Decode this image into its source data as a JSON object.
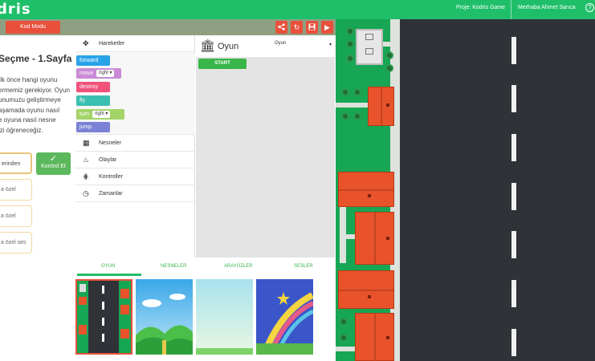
{
  "header": {
    "logo": "dris",
    "project": "Proje: Kodris Game",
    "user": "Merhaba Ahmet Sarıca",
    "help": "?"
  },
  "toolbar": {
    "mode_button": "Kod Modu",
    "icons": [
      "share-icon",
      "reset-icon",
      "save-icon",
      "play-icon"
    ]
  },
  "lesson": {
    "title": "Seçme - 1.Sayfa",
    "paragraph_lines": [
      "Ilk önce hangi oyunu",
      "ermemiz gerekiyor. Oyun",
      "unumuzu geliştirmeye",
      "aşamada oyunu nasıl",
      "e oyuna nasıl nesne",
      "izi öğreneceğiz."
    ],
    "answers": [
      "erinden",
      "a özel",
      "a özel",
      "a özel ses"
    ],
    "check_button": "Kontrol Et"
  },
  "palette": {
    "categories": [
      {
        "label": "Hareketler",
        "icon": "move-arrows-icon"
      },
      {
        "label": "Nesneler",
        "icon": "grid-icon"
      },
      {
        "label": "Olaylar",
        "icon": "fire-icon"
      },
      {
        "label": "Kontroller",
        "icon": "sliders-icon"
      },
      {
        "label": "Zamanlar",
        "icon": "clock-icon"
      }
    ],
    "blocks": [
      {
        "label": "forward",
        "color": "#29a3e8"
      },
      {
        "label": "move",
        "option": "right",
        "color": "#c98bd6"
      },
      {
        "label": "destroy",
        "color": "#f0527a"
      },
      {
        "label": "fly",
        "color": "#3bbfb0"
      },
      {
        "label": "turn",
        "option": "right",
        "color": "#a3d468"
      },
      {
        "label": "jump",
        "color": "#7a82d6"
      }
    ]
  },
  "workspace": {
    "title": "Oyun",
    "selector": "Oyun",
    "start_block": "START"
  },
  "tabs": [
    "OYUN",
    "NESNELER",
    "ARAYÜZLER",
    "SESLER"
  ],
  "colors": {
    "brand_green": "#1fbf6a",
    "accent_red": "#e8503c",
    "road": "#2f3237",
    "grass": "#17a653",
    "roof": "#e8532b"
  }
}
